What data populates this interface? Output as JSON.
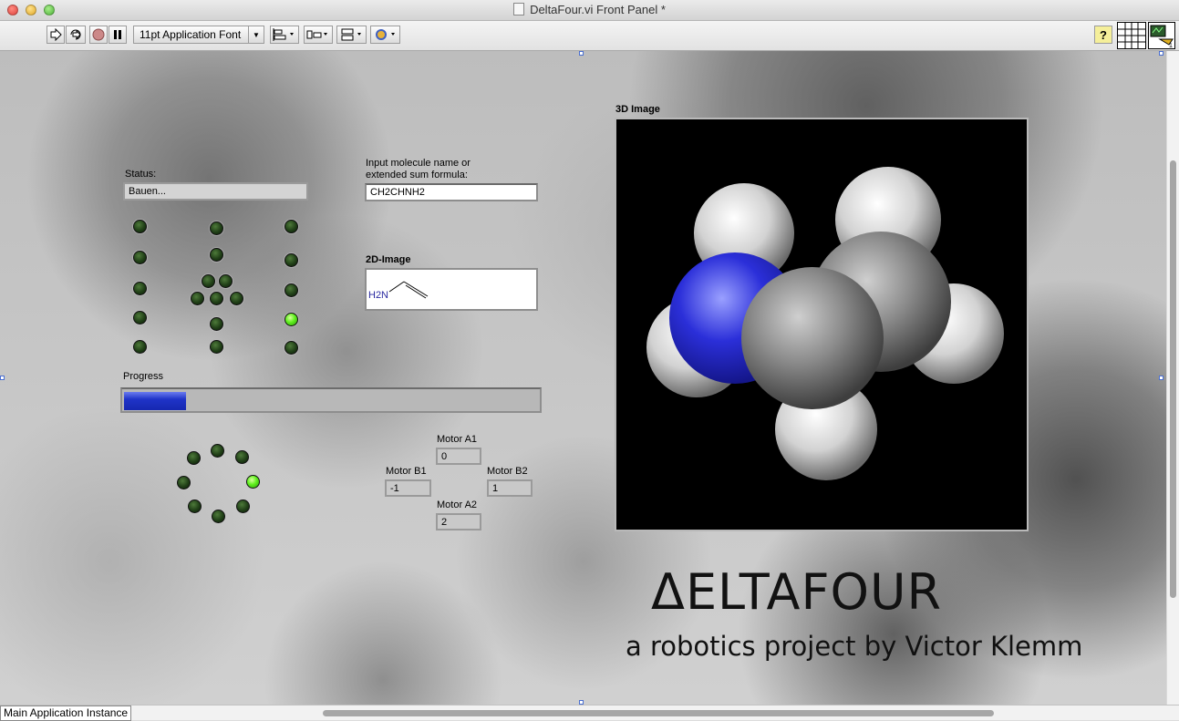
{
  "window": {
    "title": "DeltaFour.vi Front Panel *"
  },
  "toolbar": {
    "font_select": "11pt Application Font",
    "buttons": [
      "run-arrow-icon",
      "run-continuously-icon",
      "abort-icon",
      "pause-icon",
      "align-objects-icon",
      "distribute-objects-icon",
      "resize-objects-icon",
      "reorder-icon",
      "help-icon",
      "connector-pane-icon",
      "vi-icon"
    ]
  },
  "panel": {
    "status_label": "Status:",
    "status_value": "Bauen...",
    "input_label_line1": "Input molecule name or",
    "input_label_line2": "extended sum formula:",
    "input_value": "CH2CHNH2",
    "image2d_label": "2D-Image",
    "molecule_2d_text": "H2N",
    "image3d_label": "3D Image",
    "progress_label": "Progress",
    "progress_fraction": 0.15,
    "motor_a1_label": "Motor A1",
    "motor_a1_value": "0",
    "motor_b1_label": "Motor B1",
    "motor_b1_value": "-1",
    "motor_b2_label": "Motor B2",
    "motor_b2_value": "1",
    "motor_a2_label": "Motor A2",
    "motor_a2_value": "2",
    "brand_title": "ΔELTAFOUR",
    "brand_subtitle": "a robotics project by Victor Klemm"
  },
  "colors": {
    "led_on": "#5ff01e",
    "led_off": "#203f17",
    "progress_fill": "#1f33c8",
    "nitrogen": "#2b2fd9"
  },
  "statusbar": {
    "context": "Main Application Instance"
  }
}
